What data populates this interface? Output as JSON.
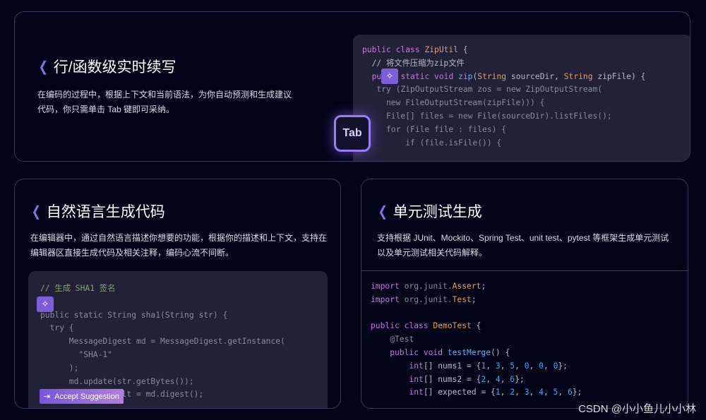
{
  "cards": [
    {
      "title": "行/函数级实时续写",
      "desc": "在编码的过程中，根据上下文和当前语法，为你自动预测和生成建议代码，你只需单击 Tab 键即可采纳。"
    },
    {
      "title": "自然语言生成代码",
      "desc": "在编辑器中，通过自然语言描述你想要的功能，根据你的描述和上下文，支持在编辑器区直接生成代码及相关注释，编码心流不间断。"
    },
    {
      "title": "单元测试生成",
      "desc": "支持根据 JUnit、Mockito、Spring Test、unit test、pytest 等框架生成单元测试以及单元测试相关代码解释。"
    }
  ],
  "tab_key": "Tab",
  "accept_button": {
    "icon": "tab-arrow-icon",
    "label": "Accept Suggestion"
  },
  "watermark": "CSDN @小小鱼儿小小林",
  "code1": [
    [
      [
        "public class ",
        "k"
      ],
      [
        "ZipUtil",
        "t"
      ],
      [
        " {",
        "p"
      ]
    ],
    [
      [
        "  // 将文件压缩为zip文件",
        "p"
      ]
    ],
    [
      [
        "  pu",
        "k"
      ],
      [
        "    ",
        "p"
      ],
      [
        "static void ",
        "k"
      ],
      [
        "zip",
        "f"
      ],
      [
        "(",
        "p"
      ],
      [
        "String",
        "t"
      ],
      [
        " sourceDir, ",
        "p"
      ],
      [
        "String",
        "t"
      ],
      [
        " zipFile) {",
        "p"
      ]
    ],
    [
      [
        "   try (ZipOutputStream zos = new ZipOutputStream(",
        "g"
      ]
    ],
    [
      [
        "     new FileOutputStream(zipFile))) {",
        "g"
      ]
    ],
    [
      [
        "     File[] files = new File(sourceDir).listFiles();",
        "g"
      ]
    ],
    [
      [
        "     for (File file : files) {",
        "g"
      ]
    ],
    [
      [
        "         if (file.isFile()) {",
        "g"
      ]
    ]
  ],
  "code2": [
    [
      [
        "// 生成 SHA1 签名",
        "c"
      ]
    ],
    [
      [
        "",
        "p"
      ]
    ],
    [
      [
        "public static String sha1(String str) {",
        "g"
      ]
    ],
    [
      [
        "  try {",
        "g"
      ]
    ],
    [
      [
        "      MessageDigest md = MessageDigest.getInstance(",
        "g"
      ]
    ],
    [
      [
        "        \"SHA-1\"",
        "g"
      ]
    ],
    [
      [
        "      );",
        "g"
      ]
    ],
    [
      [
        "      md.update(str.getBytes());",
        "g"
      ]
    ],
    [
      [
        "      byte[] result = md.digest();",
        "g"
      ]
    ]
  ],
  "code3": [
    [
      [
        "import ",
        "k"
      ],
      [
        "org.junit.",
        "g"
      ],
      [
        "Assert",
        "t"
      ],
      [
        ";",
        "p"
      ]
    ],
    [
      [
        "import ",
        "k"
      ],
      [
        "org.junit.",
        "g"
      ],
      [
        "Test",
        "t"
      ],
      [
        ";",
        "p"
      ]
    ],
    [
      [
        "",
        "p"
      ]
    ],
    [
      [
        "public class ",
        "k"
      ],
      [
        "DemoTest",
        "t"
      ],
      [
        " {",
        "p"
      ]
    ],
    [
      [
        "    @Test",
        "g"
      ]
    ],
    [
      [
        "    public void ",
        "k"
      ],
      [
        "testMerge",
        "f"
      ],
      [
        "() {",
        "p"
      ]
    ],
    [
      [
        "        int",
        "k"
      ],
      [
        "[] nums1 = {",
        "p"
      ],
      [
        "1",
        "n"
      ],
      [
        ", ",
        "p"
      ],
      [
        "3",
        "n"
      ],
      [
        ", ",
        "p"
      ],
      [
        "5",
        "n"
      ],
      [
        ", ",
        "p"
      ],
      [
        "0",
        "n"
      ],
      [
        ", ",
        "p"
      ],
      [
        "0",
        "n"
      ],
      [
        ", ",
        "p"
      ],
      [
        "0",
        "n"
      ],
      [
        "};",
        "p"
      ]
    ],
    [
      [
        "        int",
        "k"
      ],
      [
        "[] nums2 = {",
        "p"
      ],
      [
        "2",
        "n"
      ],
      [
        ", ",
        "p"
      ],
      [
        "4",
        "n"
      ],
      [
        ", ",
        "p"
      ],
      [
        "6",
        "n"
      ],
      [
        "};",
        "p"
      ]
    ],
    [
      [
        "        int",
        "k"
      ],
      [
        "[] expected = {",
        "p"
      ],
      [
        "1",
        "n"
      ],
      [
        ", ",
        "p"
      ],
      [
        "2",
        "n"
      ],
      [
        ", ",
        "p"
      ],
      [
        "3",
        "n"
      ],
      [
        ", ",
        "p"
      ],
      [
        "4",
        "n"
      ],
      [
        ", ",
        "p"
      ],
      [
        "5",
        "n"
      ],
      [
        ", ",
        "p"
      ],
      [
        "6",
        "n"
      ],
      [
        "};",
        "p"
      ]
    ]
  ]
}
